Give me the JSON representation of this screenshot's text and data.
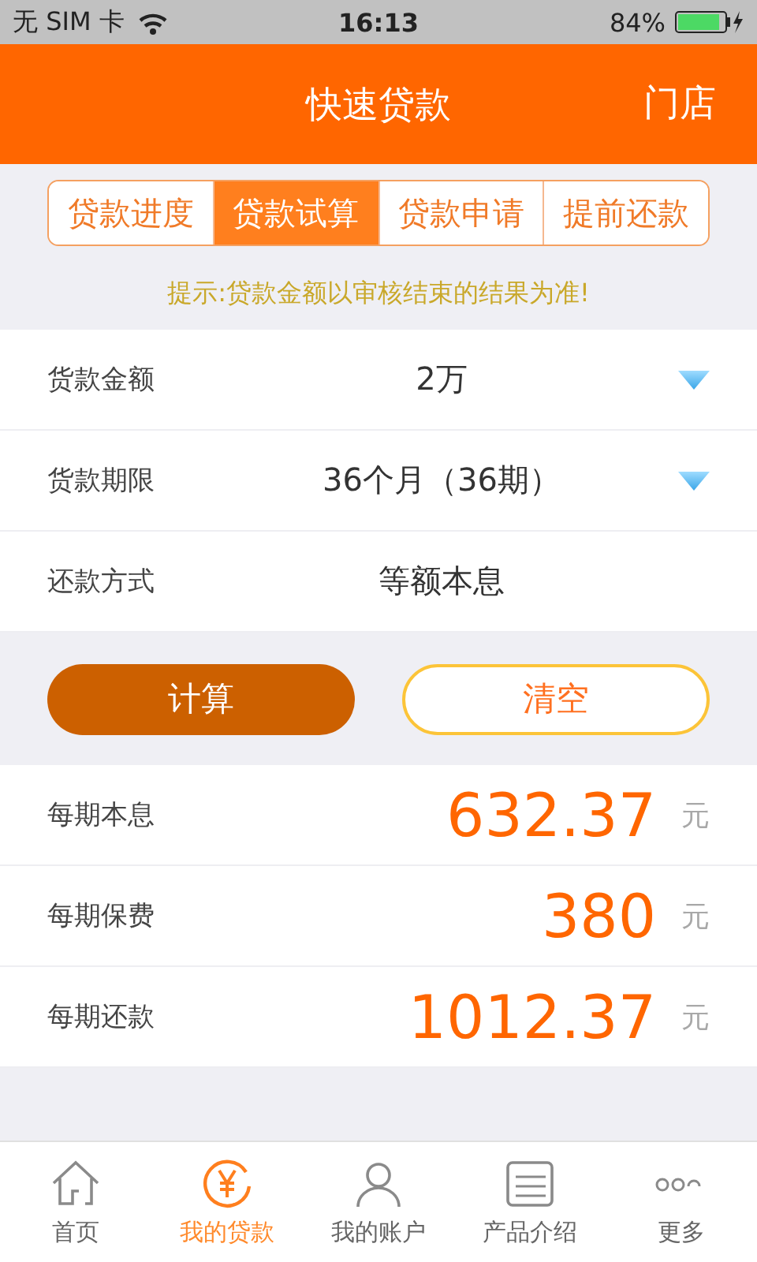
{
  "status_bar": {
    "carrier": "无 SIM 卡",
    "time": "16:13",
    "battery": "84%"
  },
  "header": {
    "title": "快速贷款",
    "action": "门店"
  },
  "segments": [
    {
      "label": "贷款进度",
      "selected": false
    },
    {
      "label": "贷款试算",
      "selected": true
    },
    {
      "label": "贷款申请",
      "selected": false
    },
    {
      "label": "提前还款",
      "selected": false
    }
  ],
  "hint": "提示:贷款金额以审核结束的结果为准!",
  "form": [
    {
      "label": "货款金额",
      "value": "2万",
      "kind": "select"
    },
    {
      "label": "货款期限",
      "value": "36个月（36期）",
      "kind": "select"
    },
    {
      "label": "还款方式",
      "value": "等额本息",
      "kind": "static"
    }
  ],
  "buttons": [
    {
      "label": "计算",
      "kind": "primary"
    },
    {
      "label": "清空",
      "kind": "secondary"
    }
  ],
  "results": [
    {
      "label": "每期本息",
      "value": "632.37",
      "unit": "元"
    },
    {
      "label": "每期保费",
      "value": "380",
      "unit": "元"
    },
    {
      "label": "每期还款",
      "value": "1012.37",
      "unit": "元"
    }
  ],
  "tab_bar": [
    {
      "label": "首页",
      "kind": "home",
      "selected": false
    },
    {
      "label": "我的贷款",
      "kind": "loan",
      "selected": true
    },
    {
      "label": "我的账户",
      "kind": "account",
      "selected": false
    },
    {
      "label": "产品介绍",
      "kind": "product",
      "selected": false
    },
    {
      "label": "更多",
      "kind": "more",
      "selected": false
    }
  ]
}
